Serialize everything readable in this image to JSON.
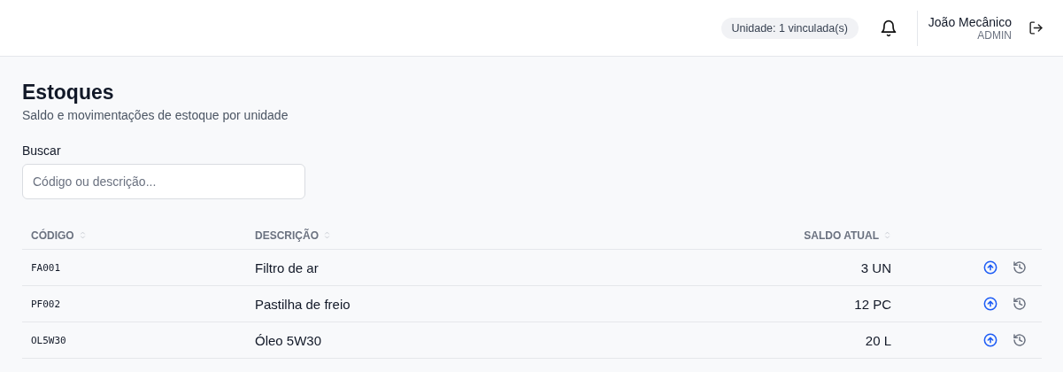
{
  "header": {
    "unit_badge": "Unidade: 1 vinculada(s)",
    "user": {
      "name": "João Mecânico",
      "role": "ADMIN"
    }
  },
  "page": {
    "title": "Estoques",
    "subtitle": "Saldo e movimentações de estoque por unidade"
  },
  "search": {
    "label": "Buscar",
    "placeholder": "Código ou descrição..."
  },
  "table": {
    "columns": [
      "CÓDIGO",
      "DESCRIÇÃO",
      "SALDO ATUAL"
    ],
    "rows": [
      {
        "code": "FA001",
        "description": "Filtro de ar",
        "balance": "3 UN"
      },
      {
        "code": "PF002",
        "description": "Pastilha de freio",
        "balance": "12 PC"
      },
      {
        "code": "OL5W30",
        "description": "Óleo 5W30",
        "balance": "20 L"
      }
    ]
  }
}
